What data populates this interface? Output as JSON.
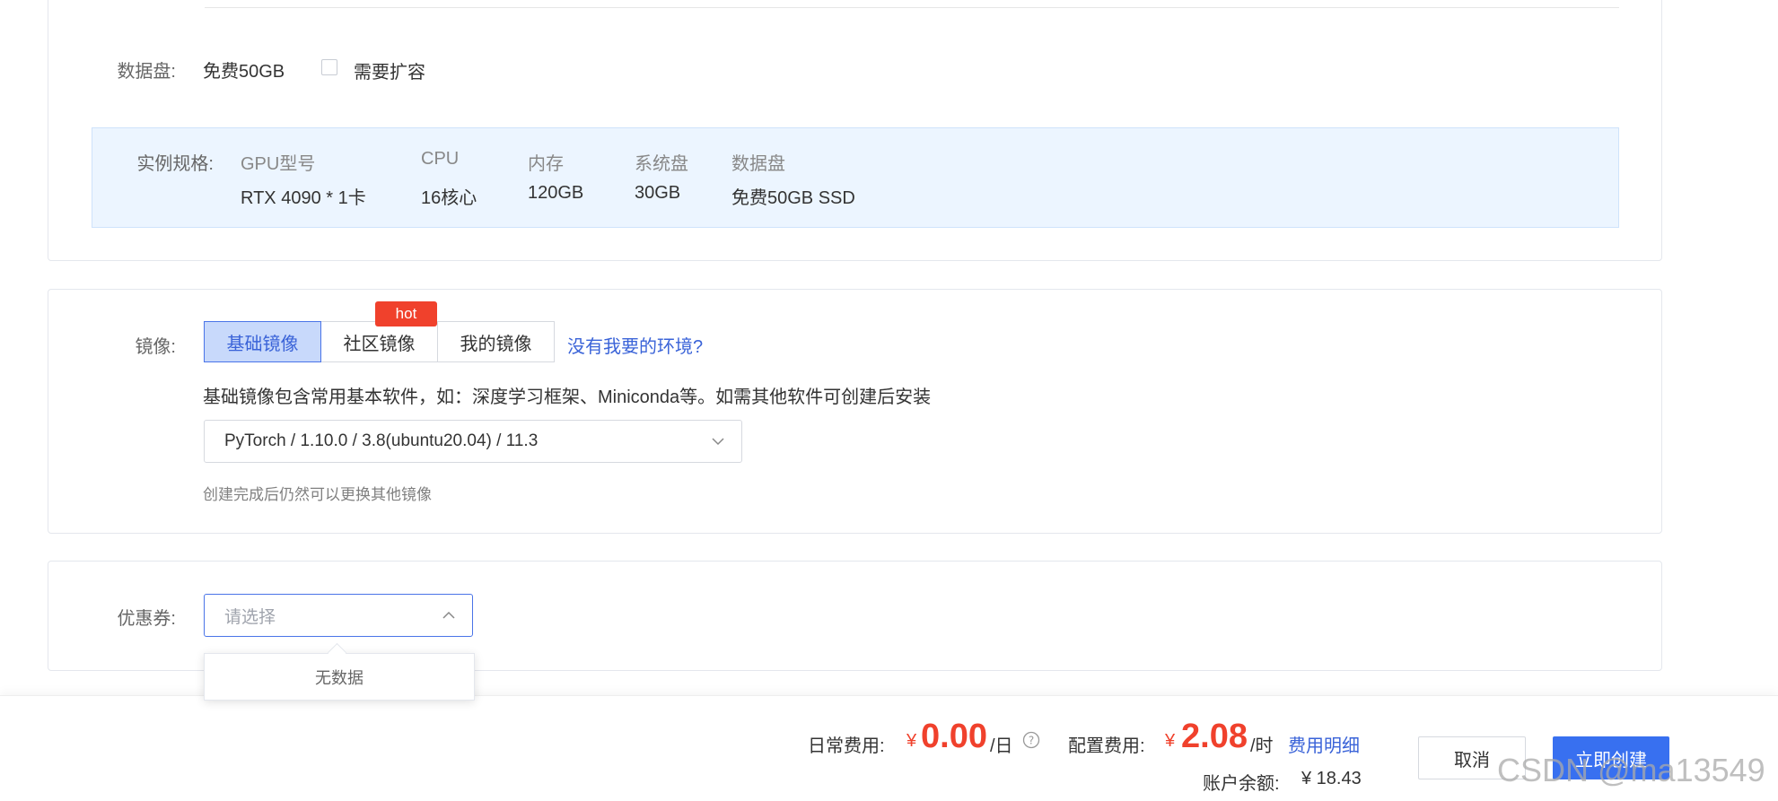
{
  "data_disk": {
    "label": "数据盘:",
    "value": "免费50GB",
    "expand_label": "需要扩容"
  },
  "spec": {
    "label": "实例规格:",
    "headers": [
      "GPU型号",
      "CPU",
      "内存",
      "系统盘",
      "数据盘"
    ],
    "values": [
      "RTX 4090 * 1卡",
      "16核心",
      "120GB",
      "30GB",
      "免费50GB SSD"
    ]
  },
  "image": {
    "label": "镜像:",
    "tabs": [
      "基础镜像",
      "社区镜像",
      "我的镜像"
    ],
    "active_tab": "基础镜像",
    "hot_badge": "hot",
    "help_link": "没有我要的环境?",
    "description": "基础镜像包含常用基本软件，如：深度学习框架、Miniconda等。如需其他软件可创建后安装",
    "selected": "PyTorch / 1.10.0 / 3.8(ubuntu20.04) / 11.3",
    "note": "创建完成后仍然可以更换其他镜像"
  },
  "coupon": {
    "label": "优惠券:",
    "placeholder": "请选择",
    "empty_text": "无数据"
  },
  "footer": {
    "daily_label": "日常费用:",
    "currency": "¥",
    "daily_price": "0.00",
    "daily_unit": "/日",
    "config_label": "配置费用:",
    "config_price": "2.08",
    "config_unit": "/时",
    "detail_link": "费用明细",
    "balance_label": "账户余额:",
    "balance_value": "¥ 18.43",
    "cancel_label": "取消",
    "create_label": "立即创建"
  },
  "watermark": "CSDN @ma13549",
  "colors": {
    "accent": "#3870f0",
    "price_red": "#f0412c",
    "spec_panel_bg": "#ecf5ff"
  }
}
